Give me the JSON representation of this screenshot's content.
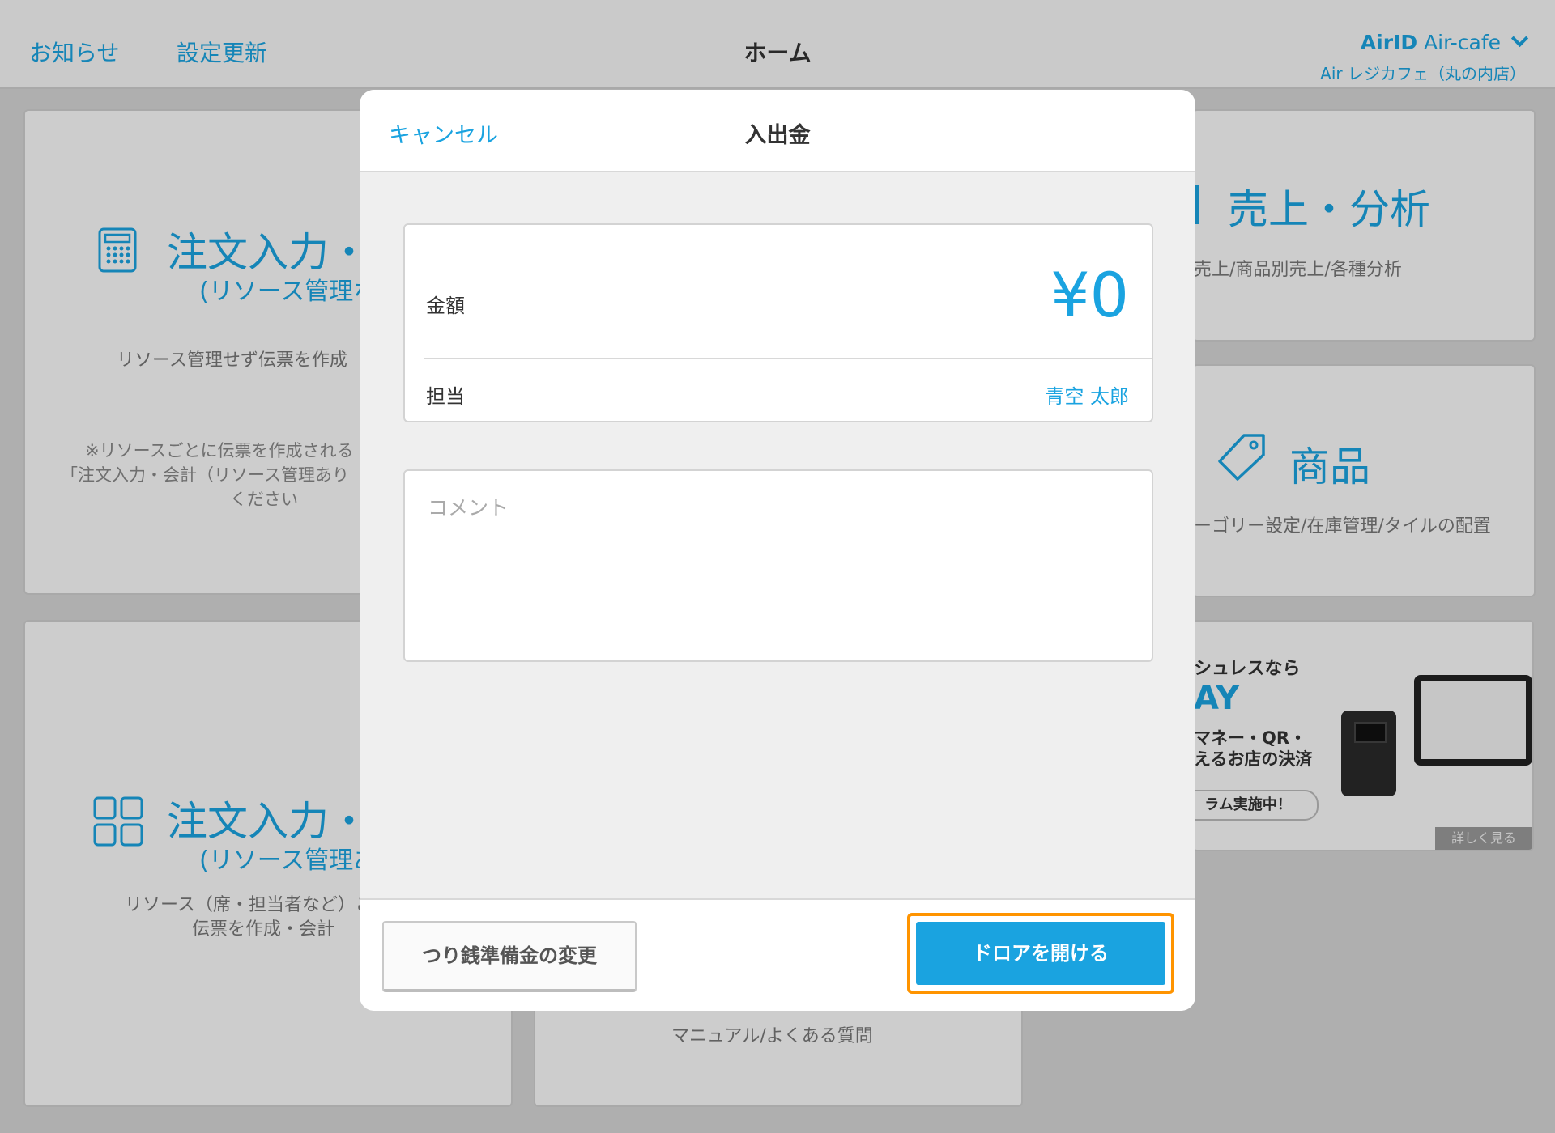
{
  "header": {
    "notice_label": "お知らせ",
    "settings_update_label": "設定更新",
    "title": "ホーム",
    "account_airid": "AirID",
    "account_name": "Air-cafe",
    "store_name": "Air レジカフェ（丸の内店）"
  },
  "cards": {
    "order_no_resource": {
      "heading": "注文入力・",
      "sub": "(リソース管理な",
      "desc": "リソース管理せず伝票を作成",
      "note_lines": [
        "※リソースごとに伝票を作成される",
        "「注文入力・会計（リソース管理あり",
        "ください"
      ]
    },
    "order_resource": {
      "heading": "注文入力・",
      "sub": "(リソース管理あ",
      "desc_lines": [
        "リソース（席・担当者など）ご",
        "伝票を作成・会計"
      ]
    },
    "sales": {
      "heading": "売上・分析",
      "desc": "売上/商品別売上/各種分析"
    },
    "products": {
      "heading": "商品",
      "desc": "ーゴリー設定/在庫管理/タイルの配置"
    },
    "help": {
      "desc": "マニュアル/よくある質問"
    },
    "ad": {
      "line1": "シュレスなら",
      "line2": "AY",
      "line3": "マネー・QR・",
      "line4": "えるお店の決済",
      "pill": "ラム実施中！",
      "more": "詳しく見る"
    }
  },
  "modal": {
    "cancel_label": "キャンセル",
    "title": "入出金",
    "amount_label": "金額",
    "amount_value": "¥0",
    "staff_label": "担当",
    "staff_value": "青空 太郎",
    "comment_placeholder": "コメント",
    "change_fund_button": "つり銭準備金の変更",
    "open_drawer_button": "ドロアを開ける"
  }
}
